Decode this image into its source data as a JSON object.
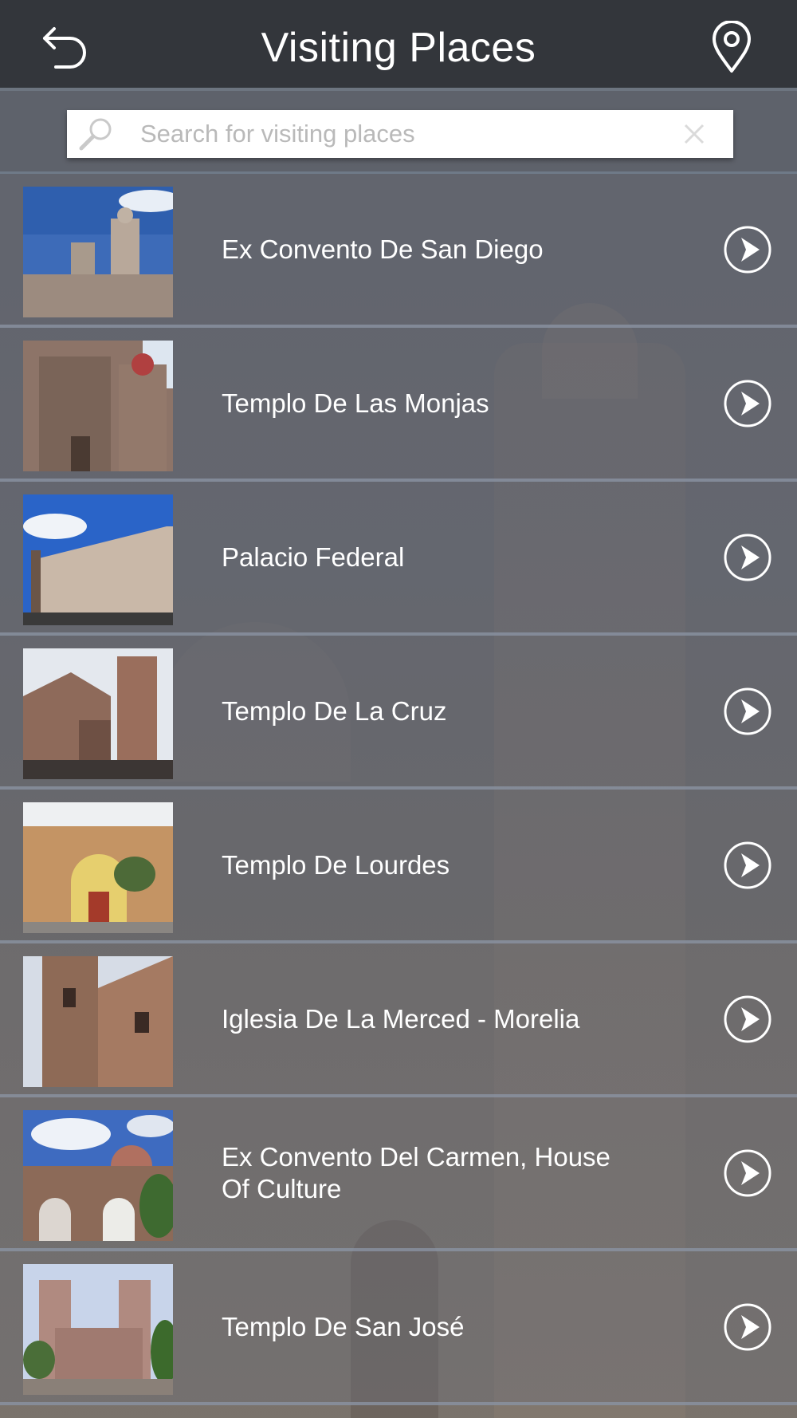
{
  "header": {
    "title": "Visiting Places",
    "back_icon": "undo-arrow-icon",
    "location_icon": "map-pin-icon"
  },
  "search": {
    "placeholder": "Search for visiting places",
    "search_icon": "magnifier-icon",
    "clear_icon": "close-icon"
  },
  "colors": {
    "header_bg": "#33363b",
    "row_divider": "#8c96a5",
    "text": "#ffffff"
  },
  "places": [
    {
      "name": "Ex Convento De San Diego"
    },
    {
      "name": "Templo De Las Monjas"
    },
    {
      "name": "Palacio Federal"
    },
    {
      "name": "Templo De La Cruz"
    },
    {
      "name": "Templo De Lourdes"
    },
    {
      "name": "Iglesia De La Merced - Morelia"
    },
    {
      "name": "Ex Convento Del Carmen, House Of Culture"
    },
    {
      "name": "Templo De San José"
    }
  ]
}
